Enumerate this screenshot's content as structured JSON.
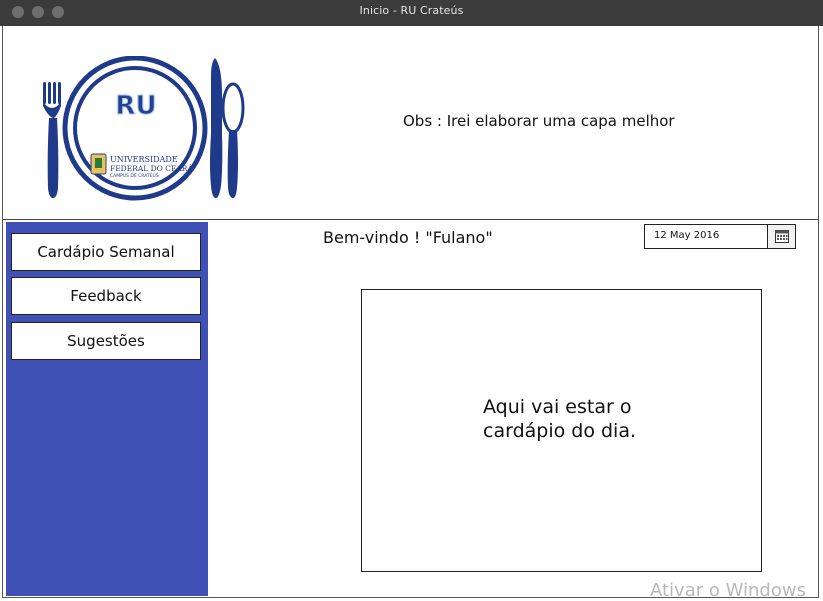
{
  "window": {
    "title": "Inicio - RU Crateús"
  },
  "header": {
    "logo": {
      "title": "RU",
      "line1": "UNIVERSIDADE",
      "line2": "FEDERAL DO CEARÁ",
      "line3": "CAMPUS DE CRATEÚS"
    },
    "note": "Obs : Irei elaborar uma capa melhor"
  },
  "sidebar": {
    "items": [
      {
        "label": "Cardápio Semanal"
      },
      {
        "label": "Feedback"
      },
      {
        "label": "Sugestões"
      }
    ],
    "color": "#3f51b5"
  },
  "main": {
    "welcome": "Bem-vindo ! \"Fulano\"",
    "date_picker": {
      "value": "12 May 2016",
      "icon": "calendar-icon"
    },
    "menu_placeholder": {
      "line1": "Aqui vai estar o",
      "line2": "cardápio do dia."
    }
  },
  "watermark": "Ativar o Windows"
}
